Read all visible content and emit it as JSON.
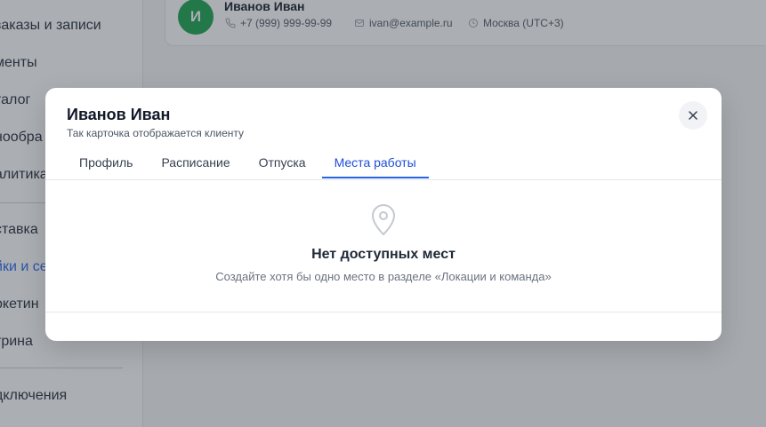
{
  "sidebar": {
    "items": [
      {
        "label": "заказы и записи"
      },
      {
        "label": "менты"
      },
      {
        "label": "талог"
      },
      {
        "label": "нообра"
      },
      {
        "label": "алитика"
      },
      {
        "label": "ставка"
      },
      {
        "label": "йки и се"
      },
      {
        "label": "ркетин"
      },
      {
        "label": "трина"
      },
      {
        "label": "дключения"
      }
    ]
  },
  "client_card": {
    "avatar_letter": "И",
    "name": "Иванов Иван",
    "phone": "+7 (999) 999-99-99",
    "email": "ivan@example.ru",
    "timezone": "Москва (UTC+3)"
  },
  "modal": {
    "title": "Иванов Иван",
    "subtitle": "Так карточка отображается клиенту",
    "tabs": [
      {
        "label": "Профиль"
      },
      {
        "label": "Расписание"
      },
      {
        "label": "Отпуска"
      },
      {
        "label": "Места работы"
      }
    ],
    "active_tab": "Места работы",
    "empty_state": {
      "icon": "map-pin-icon",
      "title": "Нет доступных мест",
      "text": "Создайте хотя бы одно место в разделе «Локации и команда»"
    }
  },
  "colors": {
    "accent": "#2563eb",
    "avatar_bg": "#16a34a",
    "overlay": "rgba(55,61,72,0.42)"
  }
}
